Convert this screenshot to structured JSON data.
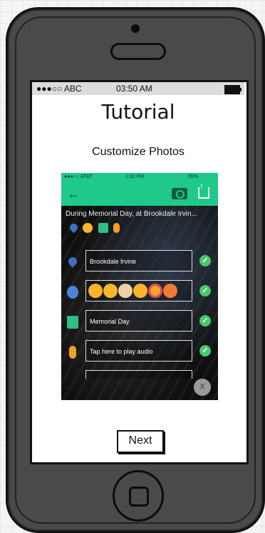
{
  "status_bar": {
    "carrier": "●●●○○ ABC",
    "time": "03:50 AM"
  },
  "title": "Tutorial",
  "subtitle": "Customize Photos",
  "preview": {
    "status": {
      "carrier": "●●●○○ AT&T",
      "time": "1:32 PM",
      "battery": "55%"
    },
    "back_icon": "arrow-left-icon",
    "camera_icon": "camera-icon",
    "share_icon": "share-icon",
    "caption": "During Memorial Day, at Brookdale Irvin...",
    "location_field": "Brookdale Irvine",
    "emoji_count": 6,
    "note_field": "Memorial Day",
    "audio_field": "Tap here to play audio",
    "close_label": "X",
    "accent_color": "#1ec98a",
    "check_color": "#47c96a"
  },
  "next_button": "Next"
}
